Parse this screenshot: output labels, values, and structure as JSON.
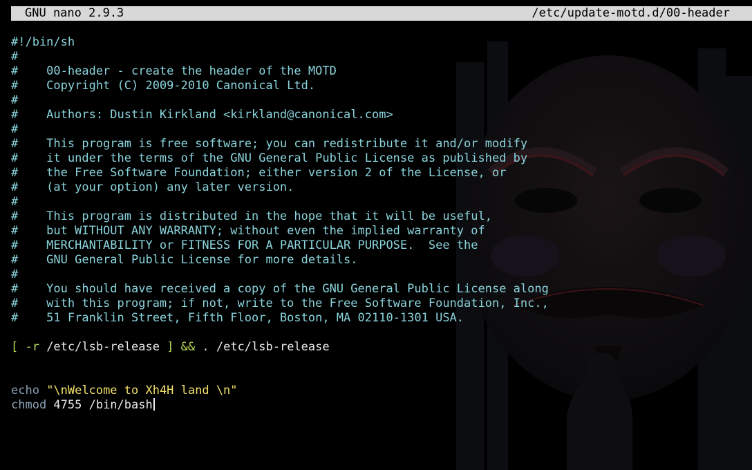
{
  "titlebar": {
    "app": "GNU nano 2.9.3",
    "file": "/etc/update-motd.d/00-header"
  },
  "editor": {
    "comment_lines": [
      "#!/bin/sh",
      "#",
      "#    00-header - create the header of the MOTD",
      "#    Copyright (C) 2009-2010 Canonical Ltd.",
      "#",
      "#    Authors: Dustin Kirkland <kirkland@canonical.com>",
      "#",
      "#    This program is free software; you can redistribute it and/or modify",
      "#    it under the terms of the GNU General Public License as published by",
      "#    the Free Software Foundation; either version 2 of the License, or",
      "#    (at your option) any later version.",
      "#",
      "#    This program is distributed in the hope that it will be useful,",
      "#    but WITHOUT ANY WARRANTY; without even the implied warranty of",
      "#    MERCHANTABILITY or FITNESS FOR A PARTICULAR PURPOSE.  See the",
      "#    GNU General Public License for more details.",
      "#",
      "#    You should have received a copy of the GNU General Public License along",
      "#    with this program; if not, write to the Free Software Foundation, Inc.,",
      "#    51 Franklin Street, Fifth Floor, Boston, MA 02110-1301 USA."
    ],
    "lsb": {
      "open": "[ -r",
      "path": " /etc/lsb-release ",
      "close": "] &&",
      "source": " . /etc/lsb-release"
    },
    "echo": {
      "cmd": "echo",
      "arg": " \"\\nWelcome to Xh4H land \\n\""
    },
    "chmod": {
      "cmd": "chmod",
      "arg": " 4755 /bin/bash"
    }
  },
  "colors": {
    "titlebar_bg": "#d8d8d8",
    "comment": "#8ad4dc",
    "bracket": "#b8dc5a",
    "string": "#f2e06a",
    "keyword": "#8aa0b4"
  }
}
